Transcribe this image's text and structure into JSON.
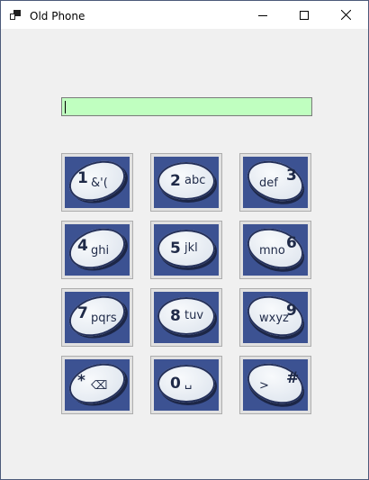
{
  "window": {
    "title": "Old Phone",
    "controls": [
      "minimize-icon",
      "maximize-icon",
      "close-icon"
    ]
  },
  "display": {
    "value": "",
    "background": "#c0ffc0"
  },
  "keypad": {
    "key_color": "#3c5292",
    "keys": [
      {
        "digit": "1",
        "letters": "&'("
      },
      {
        "digit": "2",
        "letters": "abc"
      },
      {
        "digit": "3",
        "letters": "def"
      },
      {
        "digit": "4",
        "letters": "ghi"
      },
      {
        "digit": "5",
        "letters": "jkl"
      },
      {
        "digit": "6",
        "letters": "mno"
      },
      {
        "digit": "7",
        "letters": "pqrs"
      },
      {
        "digit": "8",
        "letters": "tuv"
      },
      {
        "digit": "9",
        "letters": "wxyz"
      },
      {
        "digit": "*",
        "letters": "⌫"
      },
      {
        "digit": "0",
        "letters": "␣"
      },
      {
        "digit": "#",
        "letters": ">"
      }
    ]
  }
}
